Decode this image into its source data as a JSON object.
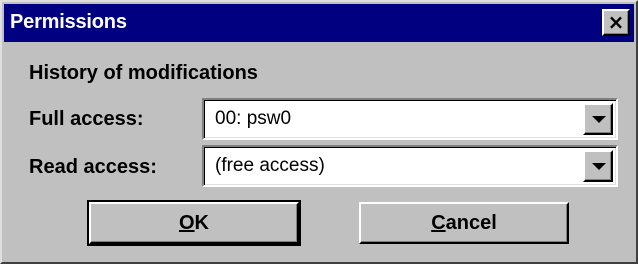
{
  "window": {
    "title": "Permissions",
    "close_label": "×"
  },
  "dialog": {
    "heading": "History of modifications",
    "full_access": {
      "label": "Full access:",
      "value": "00: psw0"
    },
    "read_access": {
      "label": "Read access:",
      "value": "(free access)"
    },
    "ok_button": {
      "mnemonic": "O",
      "rest": "K"
    },
    "cancel_button": {
      "mnemonic": "C",
      "rest": "ancel"
    }
  },
  "colors": {
    "titlebar": "#000080",
    "face": "#c0c0c0"
  },
  "icons": {
    "close": "close-icon",
    "dropdown": "chevron-down-icon"
  }
}
